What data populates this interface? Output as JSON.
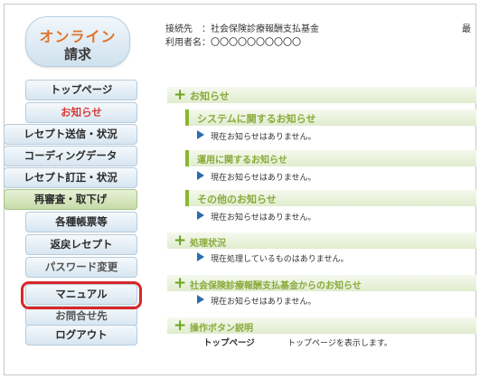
{
  "logo": {
    "line1": "オンライン",
    "line2": "請求"
  },
  "header": {
    "connection": "接続先　：社会保険診療報酬支払基金",
    "user": "利用者名：〇〇〇〇〇〇〇〇〇〇",
    "truncated": "最"
  },
  "sidebar": {
    "items": [
      {
        "label": "トップページ"
      },
      {
        "label": "お知らせ"
      },
      {
        "label": "レセプト送信・状況"
      },
      {
        "label": "コーディングデータ"
      },
      {
        "label": "レセプト訂正・状況"
      },
      {
        "label": "再審査・取下げ"
      },
      {
        "label": "各種帳票等"
      },
      {
        "label": "返戻レセプト"
      },
      {
        "label": "パスワード変更"
      },
      {
        "label": "マニュアル"
      },
      {
        "label": "お問合せ先"
      },
      {
        "label": "ログアウト"
      }
    ]
  },
  "content": {
    "notices": {
      "title": "お知らせ"
    },
    "system": {
      "title": "システムに関するお知らせ",
      "message": "現在お知らせはありません。"
    },
    "operation": {
      "title": "運用に関するお知らせ",
      "message": "現在お知らせはありません。"
    },
    "other": {
      "title": "その他のお知らせ",
      "message": "現在お知らせはありません。"
    },
    "processing": {
      "title": "処理状況",
      "message": "現在処理しているものはありません。"
    },
    "fund_notices": {
      "title": "社会保険診療報酬支払基金からのお知らせ",
      "message": "現在お知らせはありません。"
    },
    "buttons_help": {
      "title": "操作ボタン説明",
      "button_name": "トップページ",
      "button_desc": "トップページを表示します。"
    }
  },
  "colors": {
    "accent_green": "#8ab632",
    "highlight_red": "#d9262a",
    "menu_active_red": "#d83a3a"
  }
}
